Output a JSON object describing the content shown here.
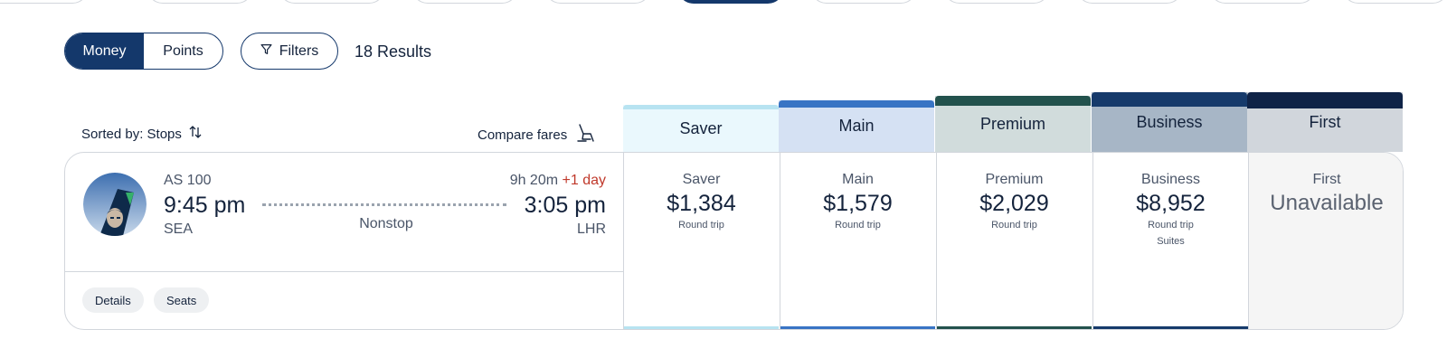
{
  "toolbar": {
    "money_label": "Money",
    "points_label": "Points",
    "filters_label": "Filters",
    "results": "18 Results"
  },
  "sort": {
    "label": "Sorted by: Stops",
    "compare_label": "Compare fares"
  },
  "fare_headers": [
    "Saver",
    "Main",
    "Premium",
    "Business",
    "First"
  ],
  "flight": {
    "number": "AS 100",
    "departure_time": "9:45 pm",
    "departure_code": "SEA",
    "stops": "Nonstop",
    "duration": "9h 20m",
    "day_offset": "+1 day",
    "arrival_time": "3:05 pm",
    "arrival_code": "LHR",
    "details_label": "Details",
    "seats_label": "Seats"
  },
  "fares": [
    {
      "name": "Saver",
      "price": "$1,384",
      "sub": "Round trip",
      "extra": ""
    },
    {
      "name": "Main",
      "price": "$1,579",
      "sub": "Round trip",
      "extra": ""
    },
    {
      "name": "Premium",
      "price": "$2,029",
      "sub": "Round trip",
      "extra": ""
    },
    {
      "name": "Business",
      "price": "$8,952",
      "sub": "Round trip",
      "extra": "Suites"
    },
    {
      "name": "First",
      "price": "Unavailable",
      "sub": "",
      "extra": ""
    }
  ],
  "colors": {
    "brand": "#14386b",
    "saver": "#b7e3f1",
    "main": "#3874c4",
    "premium": "#23524d",
    "business": "#163a6b",
    "first": "#0f2347",
    "day_offset": "#c0392b"
  }
}
